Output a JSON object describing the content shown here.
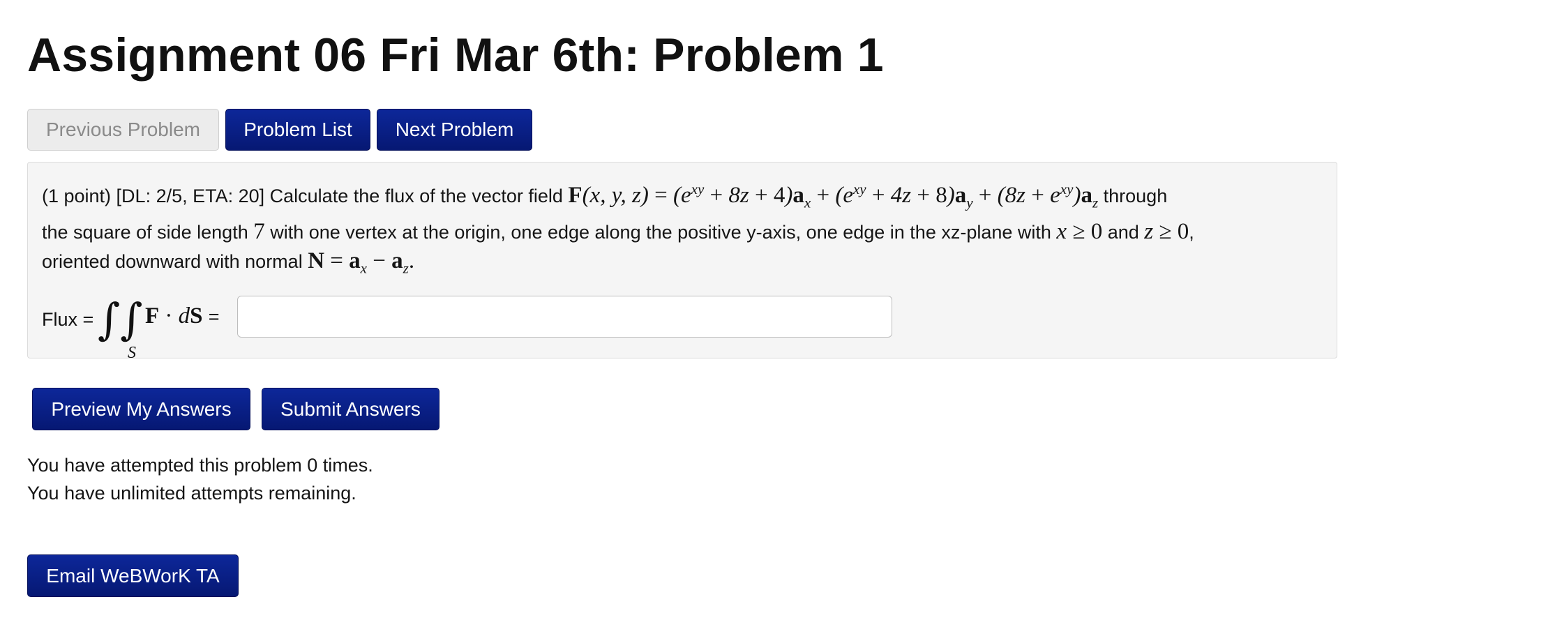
{
  "page": {
    "title": "Assignment 06 Fri Mar 6th: Problem 1"
  },
  "nav": {
    "previous_label": "Previous Problem",
    "list_label": "Problem List",
    "next_label": "Next Problem"
  },
  "problem": {
    "intro": "(1 point) [DL: 2/5, ETA: 20] Calculate the flux of the vector field ",
    "text_through": " through",
    "line2a": "the square of side length ",
    "side_length": "7",
    "line2b": " with one vertex at the origin, one edge along the positive y-axis, one edge in the xz-plane with ",
    "and_word": " and ",
    "line3a": "oriented downward with normal ",
    "flux_label": "Flux = ",
    "answer_value": "",
    "answer_placeholder": ""
  },
  "actions": {
    "preview_label": "Preview My Answers",
    "submit_label": "Submit Answers"
  },
  "status": {
    "attempts_text": "You have attempted this problem 0 times.",
    "remaining_text": "You have unlimited attempts remaining."
  },
  "footer": {
    "email_label": "Email WeBWorK TA"
  },
  "colors": {
    "button_primary": "#0a1f8a",
    "button_disabled": "#ececec",
    "panel_bg": "#f5f5f5"
  }
}
